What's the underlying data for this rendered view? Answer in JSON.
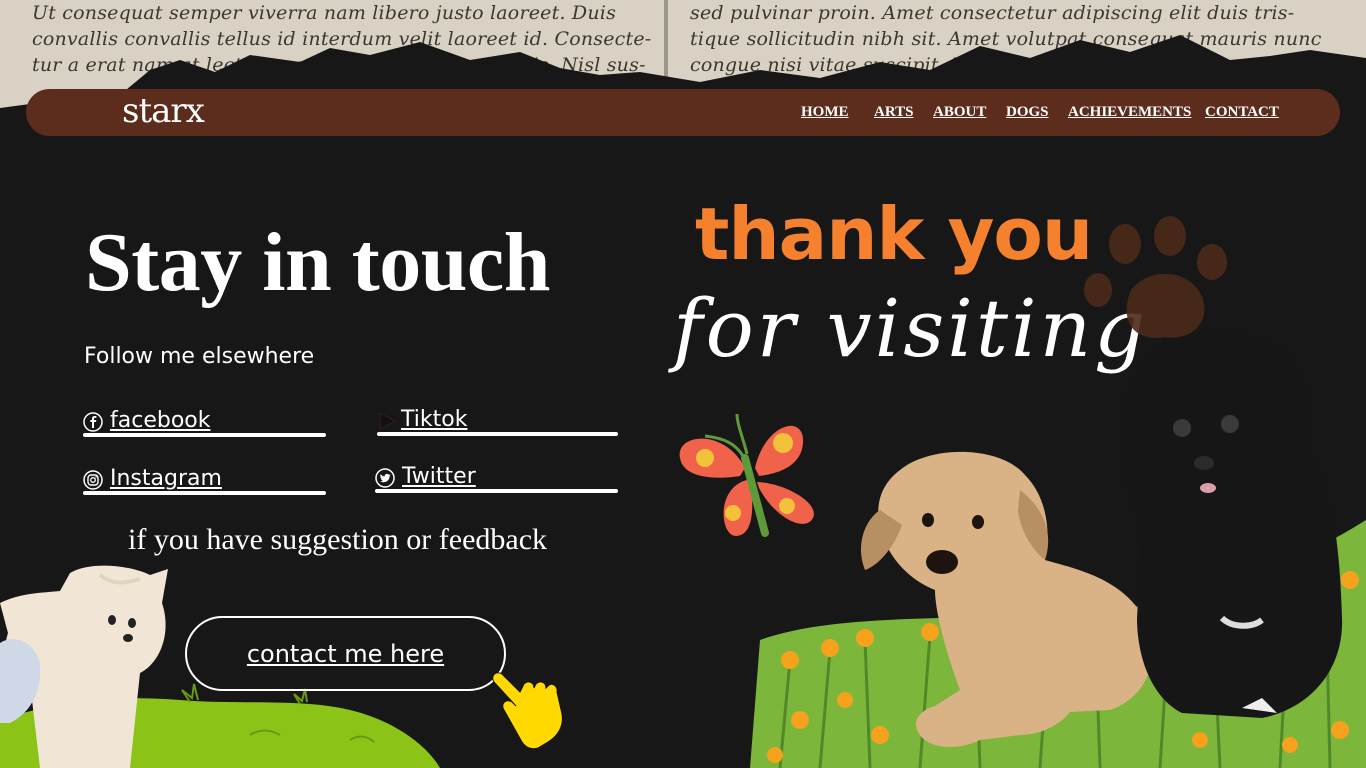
{
  "background_paper": {
    "left_lines": [
      "Ut consequat semper viverra nam libero justo laoreet. Duis",
      "convallis convallis tellus id interdum velit laoreet id. Consecte-",
      "tur a erat nam at lectus urna duis convallis convallis. Nisl sus-"
    ],
    "right_lines": [
      "sed pulvinar proin. Amet consectetur adipiscing elit duis tris-",
      "tique sollicitudin nibh sit. Amet volutpat consequat mauris nunc",
      "congue nisi vitae suscipit. Et malesuada fames"
    ]
  },
  "nav": {
    "logo": "starx",
    "links": [
      "HOME",
      "ARTS",
      "ABOUT",
      "DOGS",
      "ACHIEVEMENTS",
      "CONTACT"
    ]
  },
  "main": {
    "title": "Stay in touch",
    "subtitle": "Follow me elsewhere",
    "socials": [
      {
        "label": "facebook",
        "icon": "facebook-icon"
      },
      {
        "label": "Tiktok",
        "icon": "tiktok-icon"
      },
      {
        "label": "Instagram",
        "icon": "instagram-icon"
      },
      {
        "label": "Twitter",
        "icon": "twitter-icon"
      }
    ],
    "feedback_text": "if you have suggestion or feedback",
    "contact_button": "contact me here"
  },
  "decor": {
    "thank_you": "thank you",
    "for_visiting": "for visiting"
  },
  "colors": {
    "background": "#171717",
    "nav": "#5c2d1c",
    "accent_orange": "#f5812f",
    "grass": "#8bc417",
    "pointer_yellow": "#ffd900"
  }
}
